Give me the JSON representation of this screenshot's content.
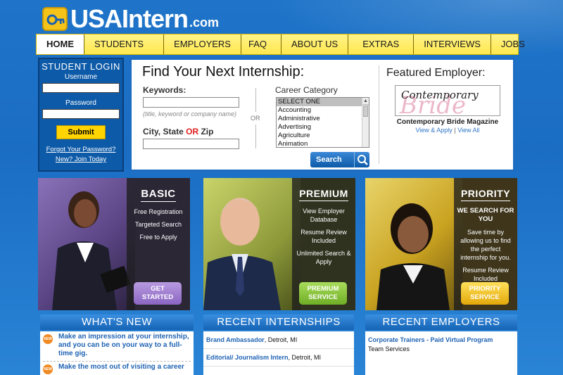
{
  "brand": {
    "name": "USAIntern",
    "suffix": ".com",
    "accent": "#ffe84d",
    "primary": "#0d5aa8",
    "logo_icon": "key-icon"
  },
  "nav": {
    "items": [
      "HOME",
      "STUDENTS",
      "EMPLOYERS",
      "FAQ",
      "ABOUT US",
      "EXTRAS",
      "INTERVIEWS",
      "JOBS"
    ],
    "active": "HOME"
  },
  "login": {
    "title": "STUDENT LOGIN",
    "username_label": "Username",
    "username_value": "",
    "password_label": "Password",
    "password_value": "",
    "submit_label": "Submit",
    "forgot_label": "Forgot Your Password?",
    "join_label": "New? Join Today"
  },
  "search": {
    "title": "Find Your Next Internship:",
    "keywords_label": "Keywords:",
    "keywords_value": "",
    "keywords_hint": "(title, keyword or company name)",
    "or_divider": "OR",
    "location_label_pre": "City, State ",
    "location_label_or": "OR",
    "location_label_post": " Zip",
    "location_value": "",
    "category_label": "Career Category",
    "category_options": [
      "SELECT ONE",
      "Accounting",
      "Administrative",
      "Advertising",
      "Agriculture",
      "Animation"
    ],
    "category_selected": "SELECT ONE",
    "search_button": "Search",
    "search_icon": "magnifier-icon"
  },
  "featured": {
    "title": "Featured Employer:",
    "logo_line1": "Contemporary",
    "logo_line2": "Bride",
    "name": "Contemporary Bride Magazine",
    "view_apply": "View & Apply",
    "separator": "|",
    "view_all": "View All"
  },
  "cards": [
    {
      "title": "BASIC",
      "features": [
        "Free Registration",
        "Targeted Search",
        "Free to Apply"
      ],
      "cta_line1": "GET",
      "cta_line2": "STARTED",
      "cta_color": "#9b72c8",
      "bg_color": "#6e5a9c"
    },
    {
      "title": "PREMIUM",
      "features": [
        "View Employer Database",
        "Resume Review Included",
        "Unlimited Search & Apply"
      ],
      "cta_line1": "PREMIUM",
      "cta_line2": "SERVICE",
      "cta_color": "#8cc63f",
      "bg_color": "#7a8a2a"
    },
    {
      "title": "PRIORITY",
      "subtitle": "WE SEARCH FOR YOU",
      "features": [
        "Save time by allowing us to find the perfect internship for you.",
        "Resume Review Included"
      ],
      "cta_line1": "PRIORITY",
      "cta_line2": "SERVICE",
      "cta_color": "#f4c20d",
      "bg_color": "#c79a1a"
    }
  ],
  "sections": {
    "whats_new": {
      "title": "WHAT'S NEW",
      "items": [
        "Make an impression at your internship, and you can be on your way to a full-time gig.",
        "Make the most out of visiting a career"
      ],
      "icon_label": "NEW"
    },
    "recent_internships": {
      "title": "RECENT INTERNSHIPS",
      "rows": [
        {
          "title": "Brand Ambassador",
          "location": ", Detroit, MI"
        },
        {
          "title": "Editorial/ Journalism Intern",
          "location": ", Detroit, MI"
        }
      ]
    },
    "recent_employers": {
      "title": "RECENT EMPLOYERS",
      "rows": [
        {
          "title": "Corporate Trainers - Paid Virtual Program",
          "subtitle": "Team Services"
        }
      ]
    }
  }
}
